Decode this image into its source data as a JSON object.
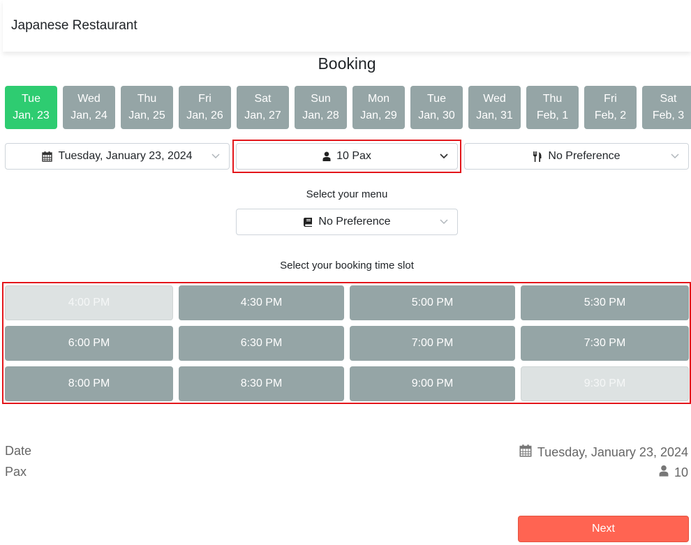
{
  "navbar": {
    "brand": "Japanese Restaurant"
  },
  "page": {
    "title": "Booking"
  },
  "days": [
    {
      "weekday": "Tue",
      "date": "Jan, 23",
      "active": true
    },
    {
      "weekday": "Wed",
      "date": "Jan, 24",
      "active": false
    },
    {
      "weekday": "Thu",
      "date": "Jan, 25",
      "active": false
    },
    {
      "weekday": "Fri",
      "date": "Jan, 26",
      "active": false
    },
    {
      "weekday": "Sat",
      "date": "Jan, 27",
      "active": false
    },
    {
      "weekday": "Sun",
      "date": "Jan, 28",
      "active": false
    },
    {
      "weekday": "Mon",
      "date": "Jan, 29",
      "active": false
    },
    {
      "weekday": "Tue",
      "date": "Jan, 30",
      "active": false
    },
    {
      "weekday": "Wed",
      "date": "Jan, 31",
      "active": false
    },
    {
      "weekday": "Thu",
      "date": "Feb, 1",
      "active": false
    },
    {
      "weekday": "Fri",
      "date": "Feb, 2",
      "active": false
    },
    {
      "weekday": "Sat",
      "date": "Feb, 3",
      "active": false
    }
  ],
  "filters": {
    "date": {
      "value": "Tuesday, January 23, 2024",
      "icon": "calendar-icon"
    },
    "pax": {
      "value": "10 Pax",
      "icon": "user-icon"
    },
    "preference": {
      "value": "No Preference",
      "icon": "utensils-icon"
    }
  },
  "menu": {
    "label": "Select your menu",
    "value": "No Preference",
    "icon": "book-icon"
  },
  "timeslots": {
    "label": "Select your booking time slot",
    "slots": [
      {
        "time": "4:00 PM",
        "available": false
      },
      {
        "time": "4:30 PM",
        "available": true
      },
      {
        "time": "5:00 PM",
        "available": true
      },
      {
        "time": "5:30 PM",
        "available": true
      },
      {
        "time": "6:00 PM",
        "available": true
      },
      {
        "time": "6:30 PM",
        "available": true
      },
      {
        "time": "7:00 PM",
        "available": true
      },
      {
        "time": "7:30 PM",
        "available": true
      },
      {
        "time": "8:00 PM",
        "available": true
      },
      {
        "time": "8:30 PM",
        "available": true
      },
      {
        "time": "9:00 PM",
        "available": true
      },
      {
        "time": "9:30 PM",
        "available": false
      }
    ]
  },
  "summary": {
    "date_label": "Date",
    "date_value": "Tuesday, January 23, 2024",
    "pax_label": "Pax",
    "pax_value": "10"
  },
  "actions": {
    "next_label": "Next"
  },
  "colors": {
    "active_day": "#2ecc71",
    "slot": "#95a5a6",
    "slot_disabled": "#dde2e2",
    "next_button": "#ff6452",
    "highlight": "#e3161b"
  }
}
